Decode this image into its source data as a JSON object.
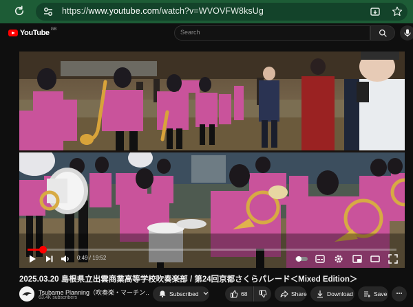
{
  "browser": {
    "url_scheme": "https://",
    "url_host": "www.youtube.com",
    "url_path": "/watch?v=WVOVFW8ksUg"
  },
  "header": {
    "logo_text": "YouTube",
    "logo_region": "GB",
    "search_placeholder": "Search"
  },
  "player": {
    "current_time": "0:49",
    "separator": " / ",
    "duration": "19:52",
    "progress_fraction": 0.041
  },
  "video_info": {
    "title": "2025.03.20 島根県立出雲商業高等学校吹奏楽部 / 第24回京都さくらパレード＜Mixed Edition＞",
    "channel_name": "Tsubame Planning（吹奏楽・マーチン…",
    "subscribers": "63.4K subscribers",
    "subscribed_label": "Subscribed",
    "like_count": "68",
    "share_label": "Share",
    "download_label": "Download",
    "save_label": "Save"
  },
  "colors": {
    "chrome_green": "#1d5c36",
    "yt_red": "#ff0000",
    "band_pink": "#c9539b"
  },
  "icons": [
    "reload-icon",
    "site-settings-icon",
    "install-app-icon",
    "bookmark-star-icon",
    "youtube-logo-icon",
    "search-icon",
    "mic-icon",
    "play-icon",
    "next-icon",
    "volume-icon",
    "subtitles-icon",
    "settings-icon",
    "miniplayer-icon",
    "theater-icon",
    "fullscreen-icon",
    "bell-icon",
    "like-icon",
    "dislike-icon",
    "share-icon",
    "download-icon",
    "save-icon",
    "more-icon"
  ]
}
